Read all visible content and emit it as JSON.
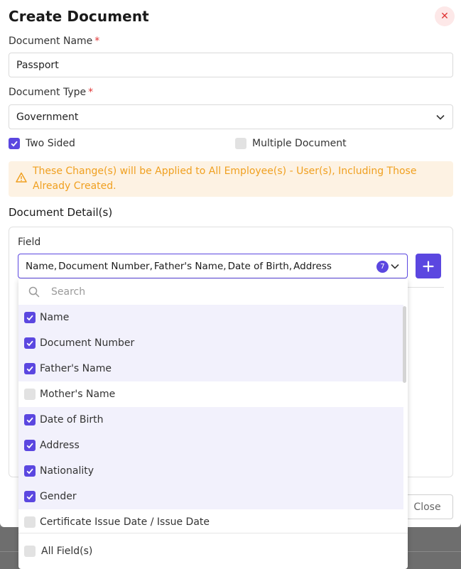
{
  "modal": {
    "title": "Create Document",
    "close_icon": "close-icon"
  },
  "form": {
    "document_name_label": "Document Name",
    "document_name_value": "Passport",
    "document_type_label": "Document Type",
    "document_type_value": "Government",
    "required_mark": "*",
    "two_sided_label": "Two Sided",
    "two_sided_checked": true,
    "multiple_document_label": "Multiple Document",
    "multiple_document_checked": false
  },
  "warning": {
    "icon": "warning-icon",
    "text": "These Change(s) will be Applied to All Employee(s) - User(s), Including Those Already Created."
  },
  "details": {
    "title": "Document Detail(s)",
    "field_label": "Field",
    "selected_items": [
      "Name",
      "Document Number",
      "Father's Name",
      "Date of Birth",
      "Address"
    ],
    "selected_count": "7",
    "close_button": "Close"
  },
  "dropdown": {
    "search_placeholder": "Search",
    "options": [
      {
        "label": "Name",
        "checked": true
      },
      {
        "label": "Document Number",
        "checked": true
      },
      {
        "label": "Father's Name",
        "checked": true
      },
      {
        "label": "Mother's Name",
        "checked": false
      },
      {
        "label": "Date of Birth",
        "checked": true
      },
      {
        "label": "Address",
        "checked": true
      },
      {
        "label": "Nationality",
        "checked": true
      },
      {
        "label": "Gender",
        "checked": true
      },
      {
        "label": "Certificate Issue Date / Issue Date",
        "checked": false
      }
    ],
    "all_fields_label": "All Field(s)"
  },
  "colors": {
    "accent": "#5b47e0",
    "danger": "#e03535",
    "warning": "#f0a020",
    "warning_bg": "#fdf2e3"
  }
}
